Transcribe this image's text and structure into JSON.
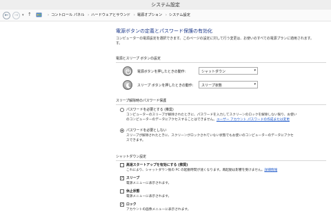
{
  "window": {
    "title": "システム設定"
  },
  "nav": {
    "breadcrumbs": [
      "コントロール パネル",
      "ハードウェアとサウンド",
      "電源オプション",
      "システム設定"
    ]
  },
  "page": {
    "heading": "電源ボタンの定義とパスワード保護の有効化",
    "description_line1": "コンピューターの電源設定を選択できます。このページの設定に対して行う変更は、お使いのすべての電源プランに適用されます。",
    "description_line2": "す。"
  },
  "power_section": {
    "title": "電源とスリープ ボタンの設定",
    "rows": [
      {
        "label": "電源ボタンを押したときの動作:",
        "selected": "シャットダウン",
        "icon": "power-icon"
      },
      {
        "label": "スリープ ボタンを押したときの動作:",
        "selected": "スリープ状態",
        "icon": "moon-icon"
      }
    ]
  },
  "wake_section": {
    "title": "スリープ解除時のパスワード保護",
    "options": [
      {
        "label": "パスワードを必要とする (推奨)",
        "checked": false,
        "desc1": "コンピューターのスリープが解除されたときに、パスワードを入力してスクリーンのロックを解除しない限り、お使い",
        "desc2_text": "のコンピューターのデータにアクセスすることはできません。",
        "desc2_link": "ユーザー アカウント パスワードの作成または変更"
      },
      {
        "label": "パスワードを必要としない",
        "checked": true,
        "desc1": "スリープが解除されたときに、スクリーンがロックされていない状態でもお使いのコンピューターのデータにアクセ",
        "desc2_text": "スできます。",
        "desc2_link": ""
      }
    ]
  },
  "shutdown_section": {
    "title": "シャットダウン設定",
    "items": [
      {
        "label": "高速スタートアップを有効にする (推奨)",
        "checked": false,
        "desc_text": "これにより、シャットダウン後の PC の起動時間が速くなります。再起動は影響を受けません。",
        "desc_link": "詳細情報"
      },
      {
        "label": "スリープ",
        "checked": true,
        "desc_text": "電源メニューに表示されます。",
        "desc_link": ""
      },
      {
        "label": "休止状態",
        "checked": false,
        "desc_text": "電源メニューに表示されます。",
        "desc_link": ""
      },
      {
        "label": "ロック",
        "checked": true,
        "desc_text": "アカウントの画像メニューに表示されます。",
        "desc_link": ""
      }
    ]
  },
  "colors": {
    "heading": "#1e3a8a",
    "link": "#1a56c9"
  }
}
